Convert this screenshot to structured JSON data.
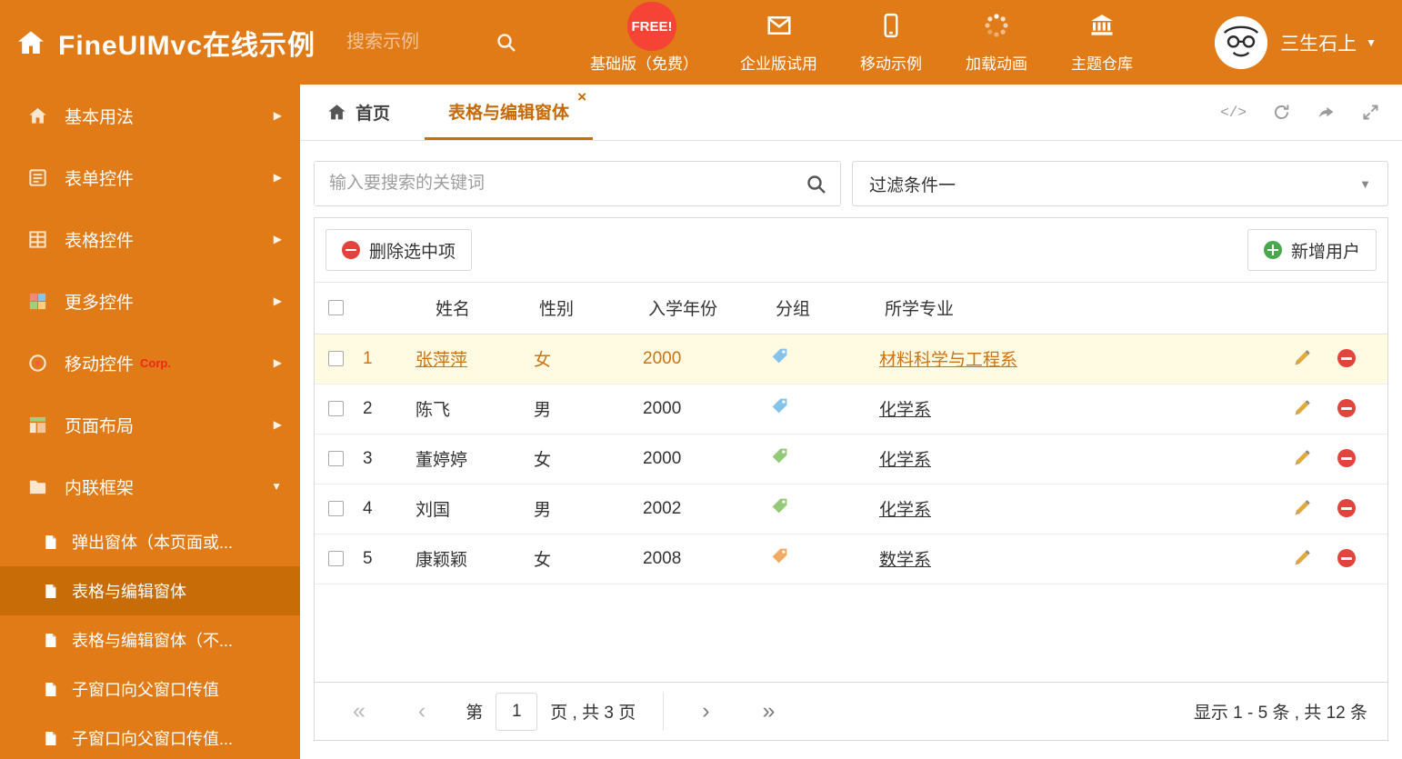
{
  "colors": {
    "accent": "#e07b18",
    "sidebar_selected": "#c86c08",
    "tab_active": "#c56a08",
    "row_highlight_bg": "#fffbe3",
    "row_highlight_text": "#cd7311",
    "free_badge_bg": "#f54335",
    "delete_red": "#e2433c",
    "add_green": "#49a84d",
    "tags": {
      "blue": "#85c3e8",
      "green": "#94ca77",
      "orange": "#f2a964"
    }
  },
  "icons": {
    "arrow_right": "▶",
    "caret_down": "▼",
    "close": "×",
    "code": "</>"
  },
  "header": {
    "title": "FineUIMvc在线示例",
    "search_placeholder": "搜索示例",
    "free_badge": "FREE!",
    "nav": [
      {
        "label": "基础版（免费）",
        "icon": "download-icon"
      },
      {
        "label": "企业版试用",
        "icon": "envelope-icon"
      },
      {
        "label": "移动示例",
        "icon": "mobile-icon"
      },
      {
        "label": "加载动画",
        "icon": "loading-icon"
      },
      {
        "label": "主题仓库",
        "icon": "bank-icon"
      }
    ],
    "user_name": "三生石上"
  },
  "sidebar": {
    "items": [
      {
        "label": "基本用法",
        "icon": "home-icon"
      },
      {
        "label": "表单控件",
        "icon": "form-icon"
      },
      {
        "label": "表格控件",
        "icon": "grid-icon"
      },
      {
        "label": "更多控件",
        "icon": "widgets-icon"
      },
      {
        "label": "移动控件",
        "icon": "mobile-icon",
        "badge": "Corp."
      },
      {
        "label": "页面布局",
        "icon": "layout-icon"
      },
      {
        "label": "内联框架",
        "icon": "frame-icon"
      }
    ],
    "subitems": [
      {
        "label": "弹出窗体（本页面或..."
      },
      {
        "label": "表格与编辑窗体"
      },
      {
        "label": "表格与编辑窗体（不..."
      },
      {
        "label": "子窗口向父窗口传值"
      },
      {
        "label": "子窗口向父窗口传值..."
      }
    ]
  },
  "tabs": {
    "home_label": "首页",
    "active_label": "表格与编辑窗体"
  },
  "filter": {
    "search_placeholder": "输入要搜索的关键词",
    "dropdown_value": "过滤条件一"
  },
  "toolbar": {
    "delete_label": "删除选中项",
    "add_label": "新增用户"
  },
  "table": {
    "columns": [
      "姓名",
      "性别",
      "入学年份",
      "分组",
      "所学专业"
    ],
    "rows": [
      {
        "num": "1",
        "name": "张萍萍",
        "gender": "女",
        "year": "2000",
        "tag": "blue",
        "major": "材料科学与工程系"
      },
      {
        "num": "2",
        "name": "陈飞",
        "gender": "男",
        "year": "2000",
        "tag": "blue",
        "major": "化学系"
      },
      {
        "num": "3",
        "name": "董婷婷",
        "gender": "女",
        "year": "2000",
        "tag": "green",
        "major": "化学系"
      },
      {
        "num": "4",
        "name": "刘国",
        "gender": "男",
        "year": "2002",
        "tag": "green",
        "major": "化学系"
      },
      {
        "num": "5",
        "name": "康颖颖",
        "gender": "女",
        "year": "2008",
        "tag": "orange",
        "major": "数学系"
      }
    ]
  },
  "pagination": {
    "first": "«",
    "prev": "‹",
    "page_prefix": "第",
    "page_value": "1",
    "page_suffix": "页 , 共 3 页",
    "next": "›",
    "last": "»",
    "summary": "显示 1 - 5 条 , 共 12 条"
  }
}
